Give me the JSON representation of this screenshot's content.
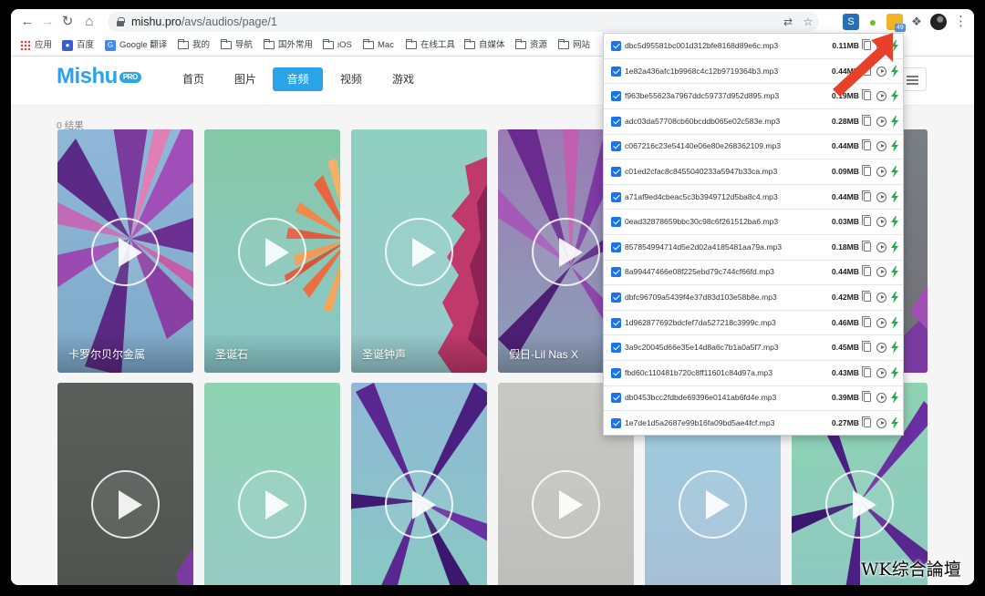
{
  "browser": {
    "url_host": "mishu.pro",
    "url_path": "/avs/audios/page/1",
    "extension_badge": "49",
    "bookmarks": [
      {
        "label": "应用",
        "icon": "apps-grid-icon"
      },
      {
        "label": "百度",
        "icon": "baidu-paw-icon"
      },
      {
        "label": "Google 翻译",
        "icon": "google-translate-icon"
      },
      {
        "label": "我的",
        "icon": "folder-icon"
      },
      {
        "label": "导航",
        "icon": "folder-icon"
      },
      {
        "label": "国外常用",
        "icon": "folder-icon"
      },
      {
        "label": "iOS",
        "icon": "folder-icon"
      },
      {
        "label": "Mac",
        "icon": "folder-icon"
      },
      {
        "label": "在线工具",
        "icon": "folder-icon"
      },
      {
        "label": "自媒体",
        "icon": "folder-icon"
      },
      {
        "label": "资源",
        "icon": "folder-icon"
      },
      {
        "label": "网站",
        "icon": "folder-icon"
      }
    ]
  },
  "site": {
    "logo": "Mishu",
    "logo_badge": "PRO",
    "nav": [
      "首页",
      "图片",
      "音频",
      "视频",
      "游戏"
    ],
    "active_nav": "音频",
    "result_count": "0 结果",
    "cards_row1": [
      "卡罗尔贝尔金属",
      "圣诞石",
      "圣诞钟声",
      "假日-Lil Nas X",
      "",
      ""
    ],
    "cards_row2": [
      "",
      "",
      "",
      "",
      "",
      ""
    ]
  },
  "popup": {
    "files": [
      {
        "name": "dbc5d95581bc001d312bfe8168d89e6c.mp3",
        "size": "0.11MB"
      },
      {
        "name": "1e82a436afc1b9968c4c12b9719364b3.mp3",
        "size": "0.44MB"
      },
      {
        "name": "f963be55623a7967ddc59737d952d895.mp3",
        "size": "0.19MB"
      },
      {
        "name": "adc03da57708cb60bcddb065e02c583e.mp3",
        "size": "0.28MB"
      },
      {
        "name": "c067216c23e54140e06e80e268362109.mp3",
        "size": "0.44MB"
      },
      {
        "name": "c01ed2cfac8c8455040233a5947b33ca.mp3",
        "size": "0.09MB"
      },
      {
        "name": "a71af9ed4cbeac5c3b3949712d5ba8c4.mp3",
        "size": "0.44MB"
      },
      {
        "name": "0ead32878659bbc30c98c6f261512ba6.mp3",
        "size": "0.03MB"
      },
      {
        "name": "857854994714d5e2d02a4185481aa79a.mp3",
        "size": "0.18MB"
      },
      {
        "name": "8a99447466e08f225ebd79c744cf66fd.mp3",
        "size": "0.44MB"
      },
      {
        "name": "dbfc96709a5439f4e37d83d103e58b8e.mp3",
        "size": "0.42MB"
      },
      {
        "name": "1d962877692bdcfef7da527218c3999c.mp3",
        "size": "0.46MB"
      },
      {
        "name": "3a9c20045d66e35e14d8a6c7b1a0a5f7.mp3",
        "size": "0.45MB"
      },
      {
        "name": "fbd60c110481b720c8ff11601c84d97a.mp3",
        "size": "0.43MB"
      },
      {
        "name": "db0453bcc2fdbde69396e0141ab6fd4e.mp3",
        "size": "0.39MB"
      },
      {
        "name": "1e7de1d5a2687e99b16fa09bd5ae4fcf.mp3",
        "size": "0.27MB"
      }
    ]
  },
  "watermark": "WK综合論壇",
  "colors": {
    "accent": "#2ba3e8",
    "checkbox": "#1a73e8",
    "arrow": "#e8412b"
  }
}
